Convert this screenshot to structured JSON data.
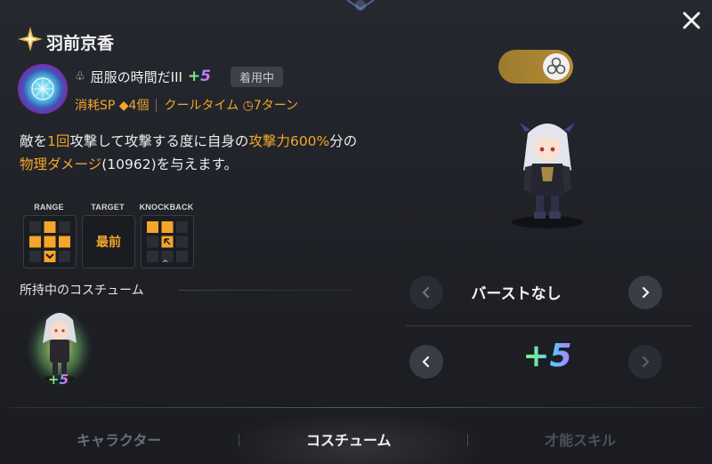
{
  "header": {
    "character_name": "羽前京香",
    "close_icon": "close-icon"
  },
  "skill": {
    "icon": "skill-emblem-icon",
    "prefix_icon": "clover-icon",
    "name": "屈服の時間だIII",
    "upgrade": "+5",
    "equipped_badge": "着用中",
    "sp_cost": "消耗SP ◆4個",
    "cooldown": "クールタイム ◷7ターン",
    "description": {
      "p1": "敵を",
      "hit_count": "1回",
      "p2": "攻撃して攻撃する度に自身の",
      "stat": "攻撃力",
      "percent": "600%",
      "p3": "分の",
      "dmg_type": "物理ダメージ",
      "p4": "(10962)を与えます。"
    }
  },
  "skill_stats": {
    "range_label": "RANGE",
    "target_label": "TARGET",
    "target_value": "最前",
    "knockback_label": "KNOCKBACK"
  },
  "costumes": {
    "heading": "所持中のコスチューム",
    "items": [
      {
        "upgrade": "+5"
      }
    ]
  },
  "right_panel": {
    "toggle_icon": "flower-icon",
    "burst_label": "バーストなし",
    "upgrade_display": "+5"
  },
  "tabs": [
    {
      "label": "キャラクター",
      "active": false
    },
    {
      "label": "コスチューム",
      "active": true
    },
    {
      "label": "才能スキル",
      "active": false
    }
  ],
  "colors": {
    "accent": "#f4a52a",
    "background": "#1f2127",
    "toggle": "#b48c35"
  }
}
